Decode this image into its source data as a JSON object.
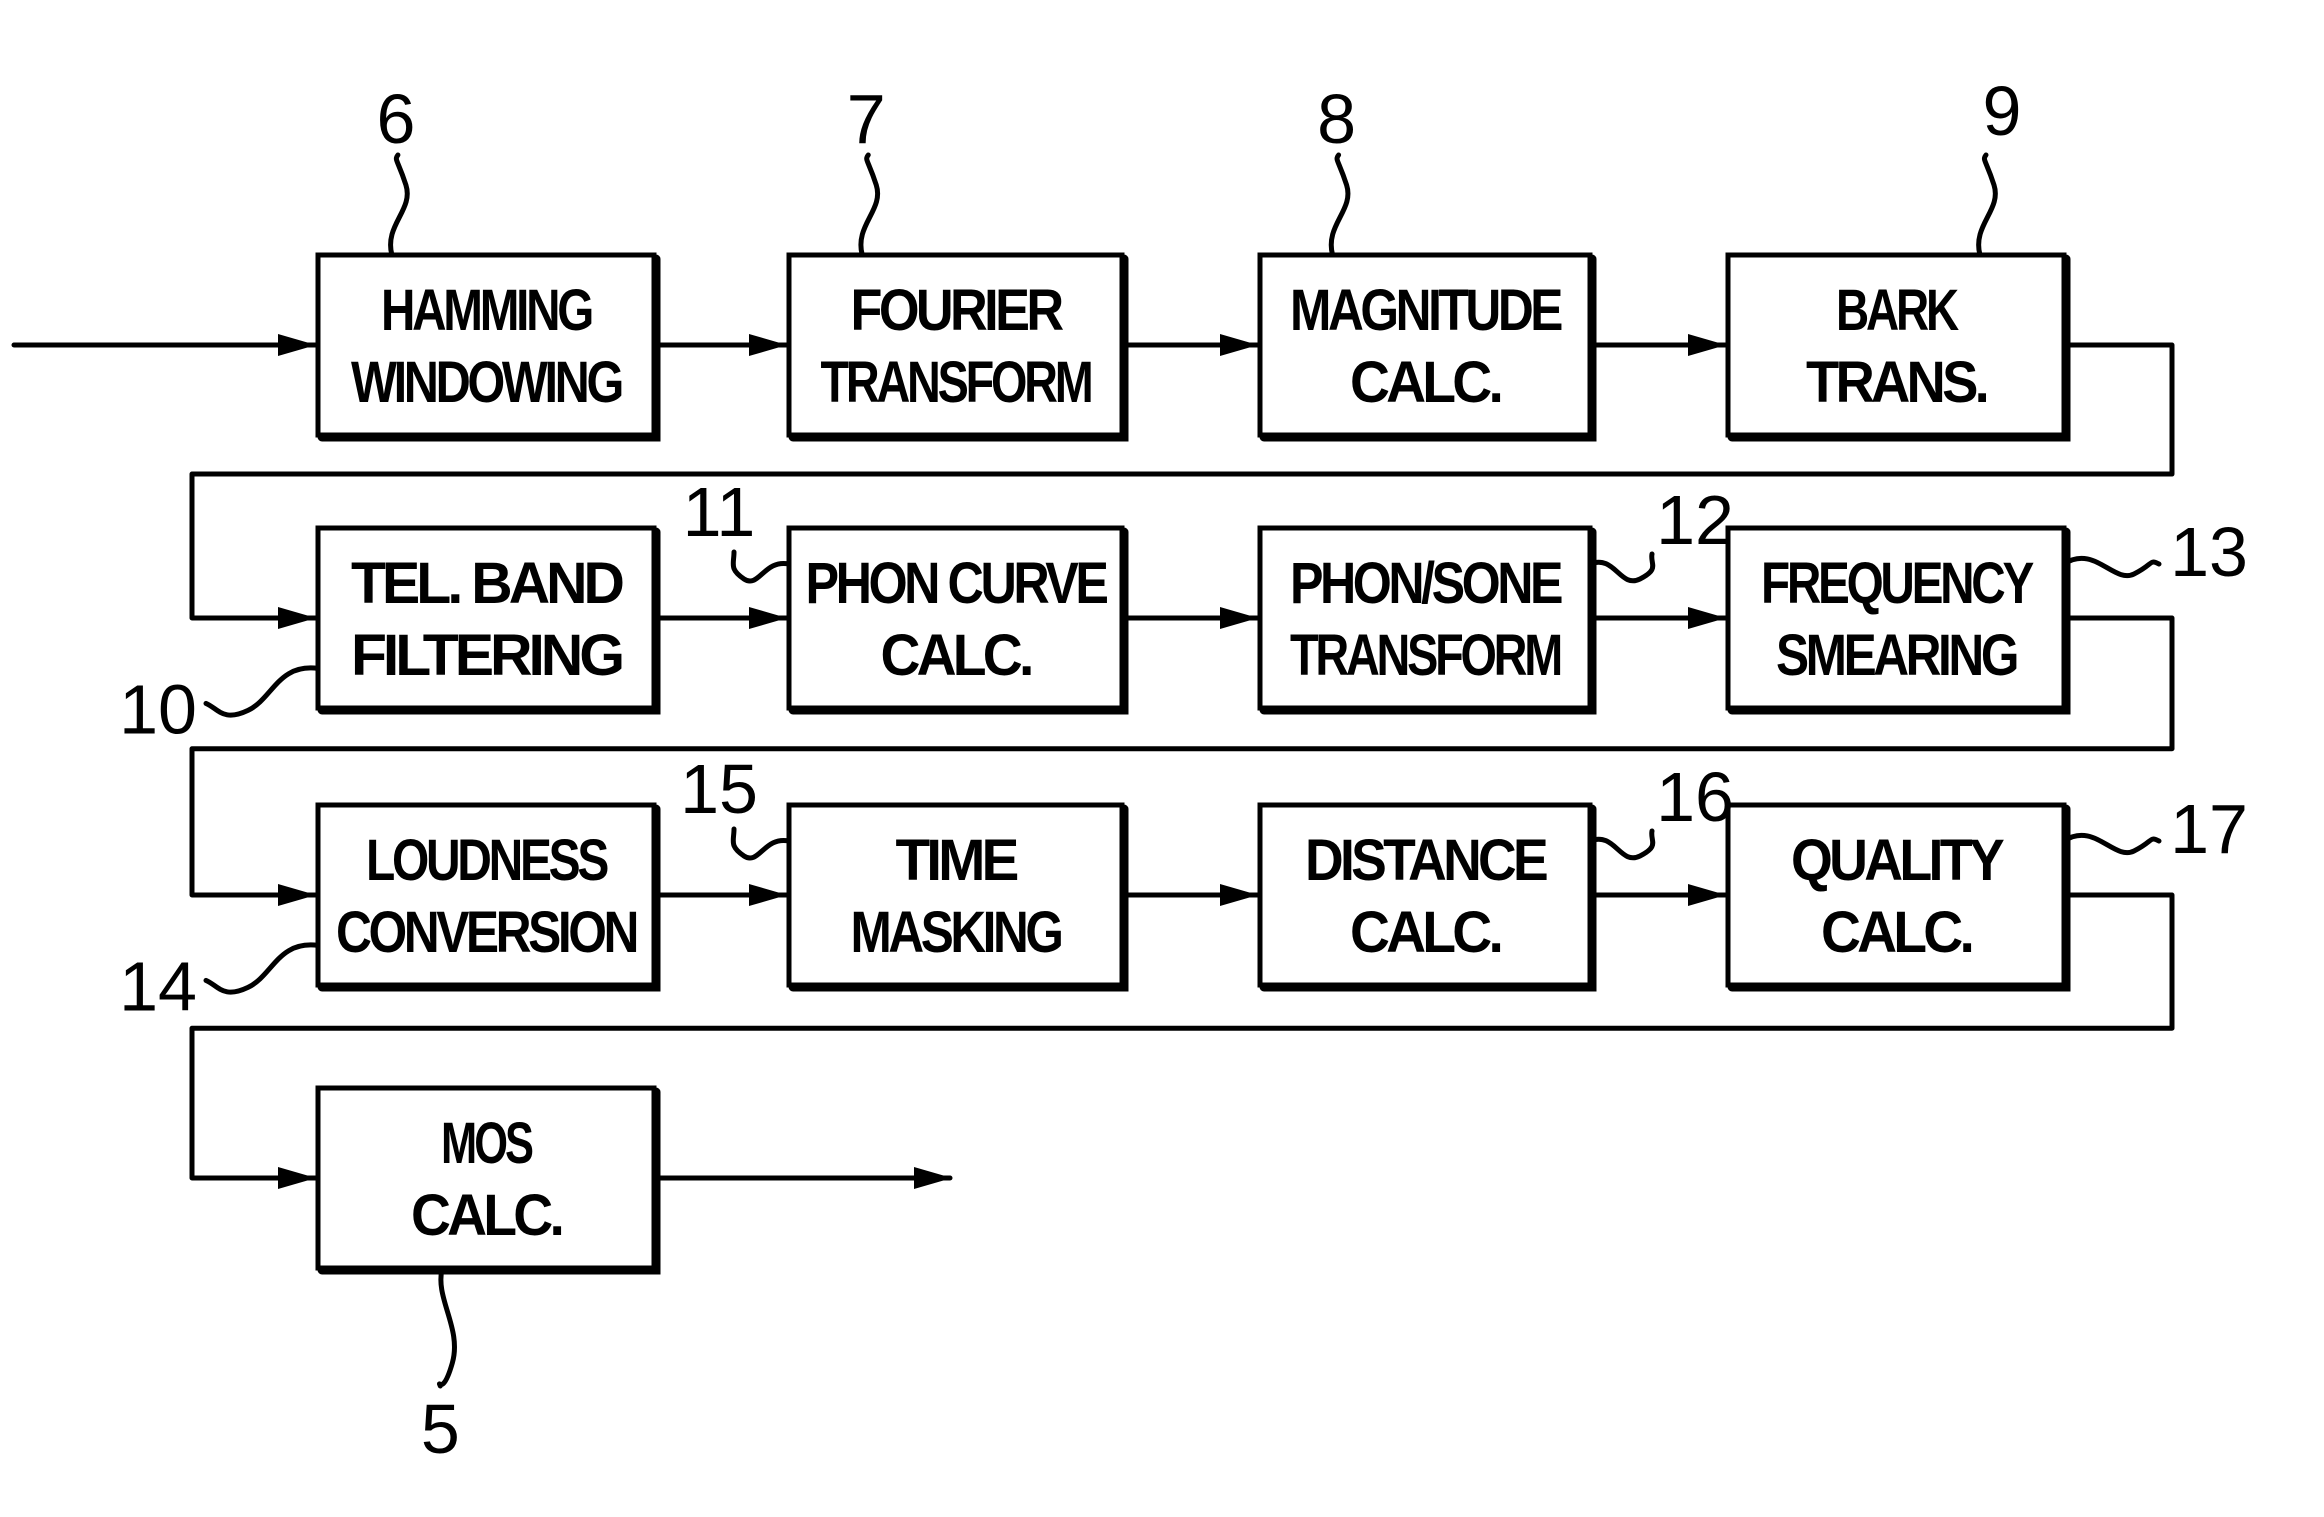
{
  "diagram": {
    "type": "signal-processing-flowchart",
    "colors": {
      "stroke": "#000000",
      "background": "#ffffff"
    },
    "blocks": [
      {
        "id": "hamming",
        "ref": "6",
        "lines": [
          "HAMMING",
          "WINDOWING"
        ]
      },
      {
        "id": "fourier",
        "ref": "7",
        "lines": [
          "FOURIER",
          "TRANSFORM"
        ]
      },
      {
        "id": "magnitude",
        "ref": "8",
        "lines": [
          "MAGNITUDE",
          "CALC."
        ]
      },
      {
        "id": "bark",
        "ref": "9",
        "lines": [
          "BARK",
          "TRANS."
        ]
      },
      {
        "id": "tel-band",
        "ref": "10",
        "lines": [
          "TEL. BAND",
          "FILTERING"
        ]
      },
      {
        "id": "phon-curve",
        "ref": "11",
        "lines": [
          "PHON CURVE",
          "CALC."
        ]
      },
      {
        "id": "phon-sone",
        "ref": "12",
        "lines": [
          "PHON/SONE",
          "TRANSFORM"
        ]
      },
      {
        "id": "freq-smearing",
        "ref": "13",
        "lines": [
          "FREQUENCY",
          "SMEARING"
        ]
      },
      {
        "id": "loudness",
        "ref": "14",
        "lines": [
          "LOUDNESS",
          "CONVERSION"
        ]
      },
      {
        "id": "time-masking",
        "ref": "15",
        "lines": [
          "TIME",
          "MASKING"
        ]
      },
      {
        "id": "distance",
        "ref": "16",
        "lines": [
          "DISTANCE",
          "CALC."
        ]
      },
      {
        "id": "quality",
        "ref": "17",
        "lines": [
          "QUALITY",
          "CALC."
        ]
      },
      {
        "id": "mos",
        "ref": "5",
        "lines": [
          "MOS",
          "CALC."
        ]
      }
    ],
    "flow": [
      [
        "input",
        "hamming"
      ],
      [
        "hamming",
        "fourier"
      ],
      [
        "fourier",
        "magnitude"
      ],
      [
        "magnitude",
        "bark"
      ],
      [
        "bark",
        "tel-band"
      ],
      [
        "tel-band",
        "phon-curve"
      ],
      [
        "phon-curve",
        "phon-sone"
      ],
      [
        "phon-sone",
        "freq-smearing"
      ],
      [
        "freq-smearing",
        "loudness"
      ],
      [
        "loudness",
        "time-masking"
      ],
      [
        "time-masking",
        "distance"
      ],
      [
        "distance",
        "quality"
      ],
      [
        "quality",
        "mos"
      ],
      [
        "mos",
        "output"
      ]
    ]
  }
}
